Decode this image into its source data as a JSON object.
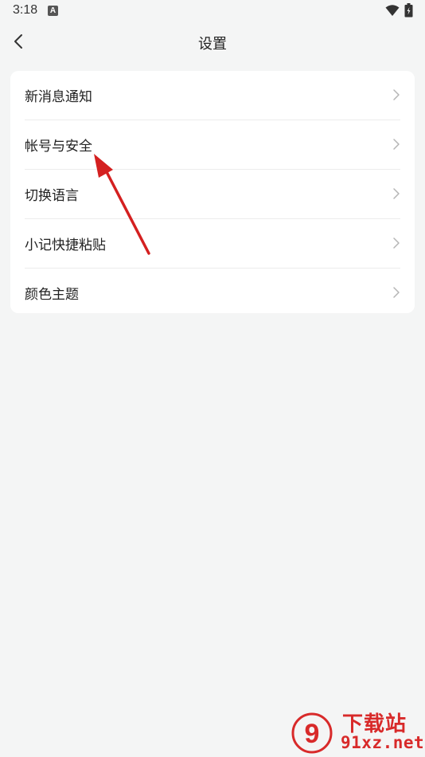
{
  "status_bar": {
    "time": "3:18",
    "notification_letter": "A"
  },
  "header": {
    "title": "设置"
  },
  "settings": {
    "items": [
      {
        "label": "新消息通知"
      },
      {
        "label": "帐号与安全"
      },
      {
        "label": "切换语言"
      },
      {
        "label": "小记快捷粘贴"
      },
      {
        "label": "颜色主题"
      }
    ]
  },
  "watermark": {
    "logo_glyph": "9",
    "title": "下载站",
    "domain": "91xz.net"
  },
  "colors": {
    "background": "#f4f5f5",
    "card": "#ffffff",
    "annotation_arrow": "#d42020",
    "watermark": "#d82a2a"
  }
}
